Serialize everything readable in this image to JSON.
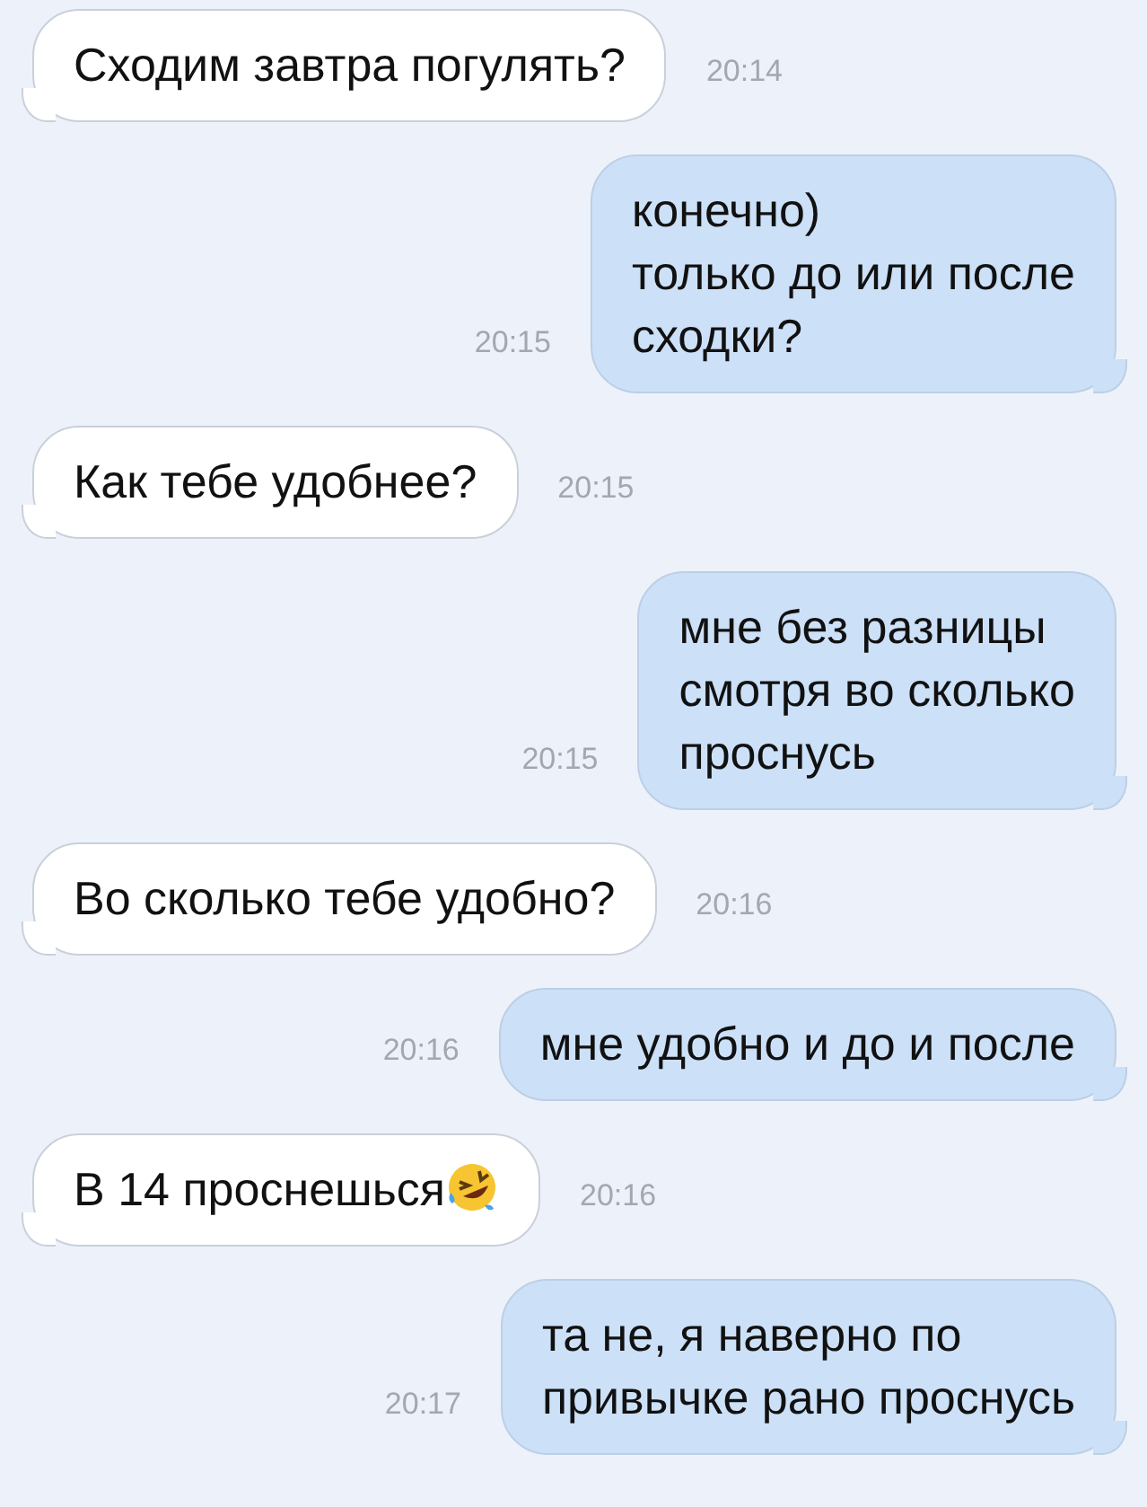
{
  "messages": [
    {
      "kind": "incoming",
      "text": "Сходим завтра погулять?",
      "time": "20:14"
    },
    {
      "kind": "outgoing",
      "text": "конечно)\nтолько до или после\nсходки?",
      "time": "20:15"
    },
    {
      "kind": "incoming",
      "text": "Как тебе удобнее?",
      "time": "20:15"
    },
    {
      "kind": "outgoing",
      "text": "мне без разницы\nсмотря во сколько\nпроснусь",
      "time": "20:15"
    },
    {
      "kind": "incoming",
      "text": "Во сколько тебе удобно?",
      "time": "20:16"
    },
    {
      "kind": "outgoing",
      "text": "мне удобно и до и после",
      "time": "20:16"
    },
    {
      "kind": "incoming",
      "text": "В 14 проснешься",
      "time": "20:16",
      "emoji": true
    },
    {
      "kind": "outgoing",
      "text": "та не, я наверно по\nпривычке рано проснусь",
      "time": "20:17"
    }
  ]
}
